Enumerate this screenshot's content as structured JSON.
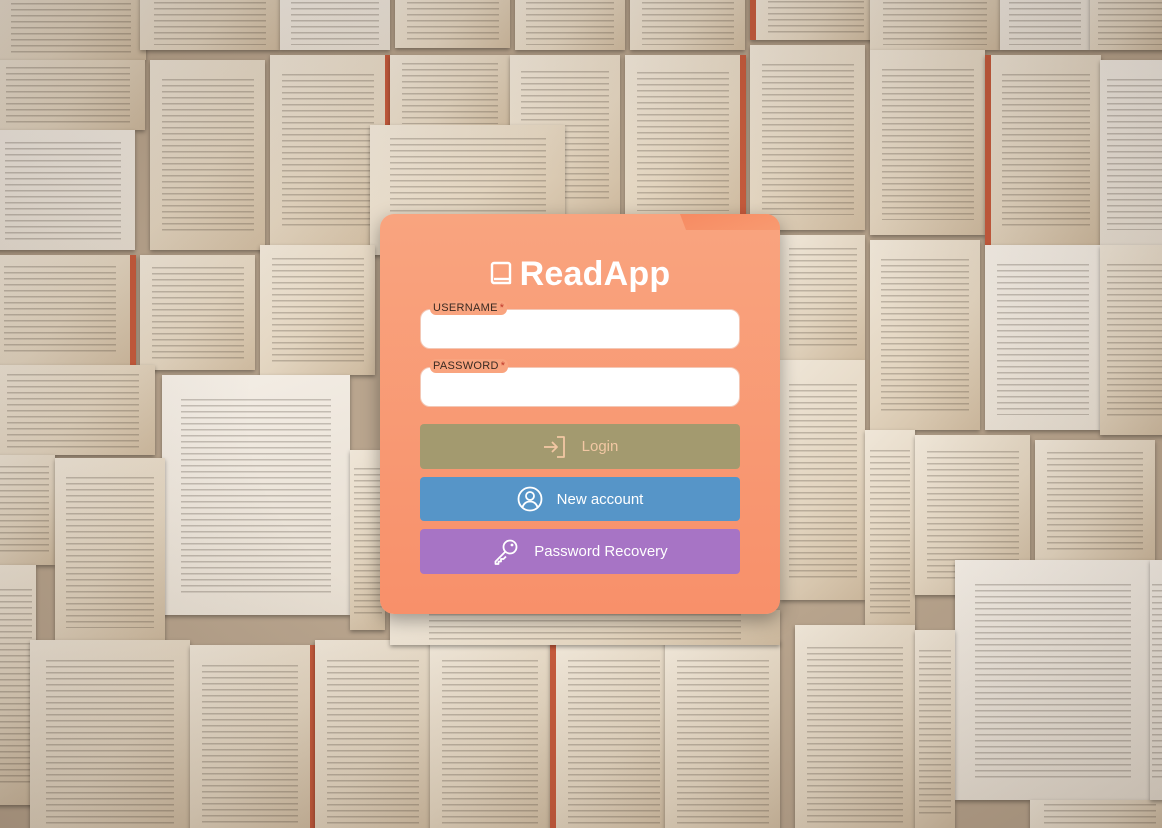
{
  "app": {
    "title": "ReadApp",
    "logo_icon": "book-icon"
  },
  "form": {
    "username": {
      "label": "USERNAME",
      "required_mark": "*",
      "value": "",
      "placeholder": ""
    },
    "password": {
      "label": "PASSWORD",
      "required_mark": "*",
      "value": "",
      "placeholder": ""
    }
  },
  "buttons": {
    "login": {
      "label": "Login",
      "icon": "login-arrow-icon",
      "disabled": true
    },
    "new_account": {
      "label": "New account",
      "icon": "user-circle-icon"
    },
    "password_recovery": {
      "label": "Password Recovery",
      "icon": "key-icon"
    }
  },
  "colors": {
    "card": "#f9a47f",
    "login_button": "#a39a6f",
    "new_account_button": "#5695c8",
    "recovery_button": "#a774c5",
    "background_accent": "#c45a3c"
  },
  "background": {
    "description_icon": "open-books-background"
  }
}
